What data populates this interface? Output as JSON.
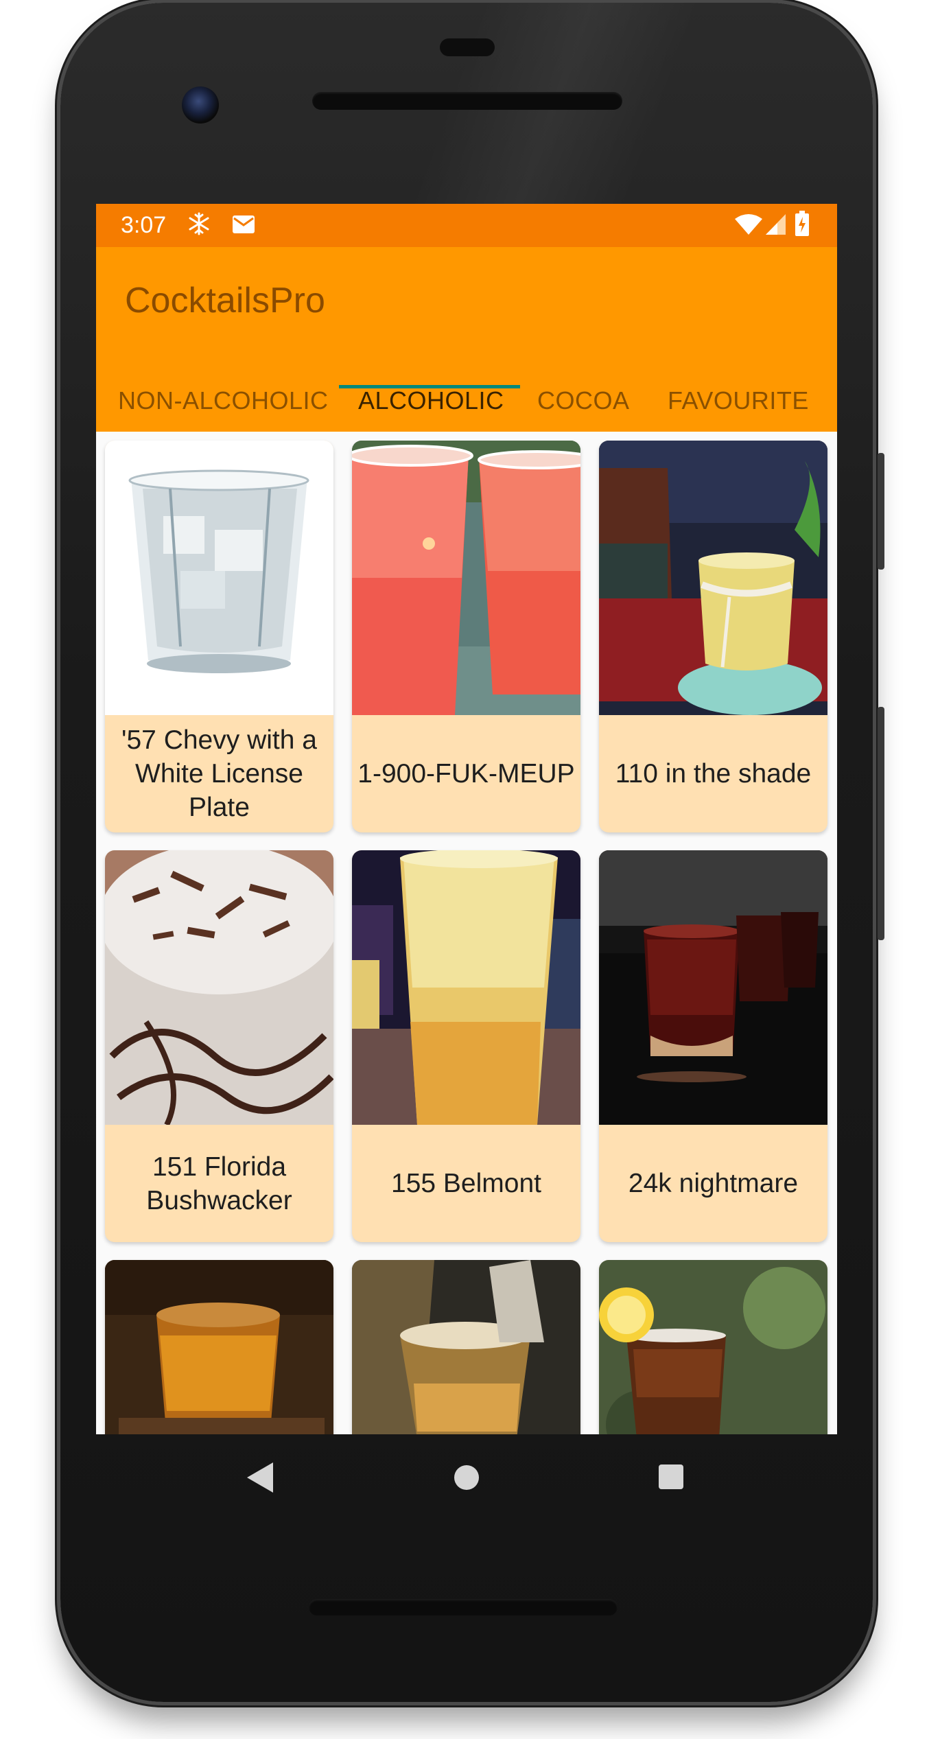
{
  "status_bar": {
    "time": "3:07",
    "left_icons": [
      "snowflake-icon",
      "mail-icon"
    ],
    "right_icons": [
      "wifi-icon",
      "signal-icon",
      "battery-icon"
    ]
  },
  "app": {
    "title": "CocktailsPro"
  },
  "tabs": [
    {
      "label": "NON-ALCOHOLIC",
      "active": false
    },
    {
      "label": "ALCOHOLIC",
      "active": true
    },
    {
      "label": "COCOA",
      "active": false
    },
    {
      "label": "FAVOURITE",
      "active": false
    }
  ],
  "cocktails": [
    {
      "name": "'57 Chevy with a White License Plate"
    },
    {
      "name": "1-900-FUK-MEUP"
    },
    {
      "name": "110 in the shade"
    },
    {
      "name": "151 Florida Bushwacker"
    },
    {
      "name": "155 Belmont"
    },
    {
      "name": "24k nightmare"
    },
    {
      "name": ""
    },
    {
      "name": ""
    },
    {
      "name": ""
    }
  ],
  "colors": {
    "status_bar": "#f57c00",
    "app_bar": "#ff9800",
    "tab_indicator": "#00897b",
    "card_label_bg": "#ffe0b2"
  },
  "nav_bar": {
    "buttons": [
      "back-icon",
      "home-icon",
      "recents-icon"
    ]
  }
}
